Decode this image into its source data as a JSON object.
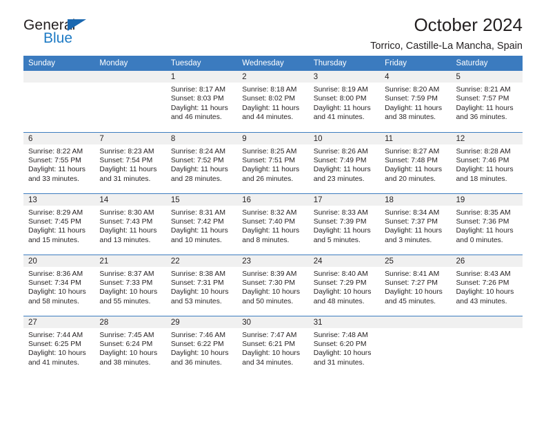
{
  "brand": {
    "name_part1": "General",
    "name_part2": "Blue"
  },
  "header": {
    "title": "October 2024",
    "subtitle": "Torrico, Castille-La Mancha, Spain"
  },
  "colors": {
    "header_blue": "#3b7bbf",
    "logo_blue": "#1d7ac4",
    "daynum_band": "#f0f0f0",
    "text": "#231f20"
  },
  "weekdays": [
    "Sunday",
    "Monday",
    "Tuesday",
    "Wednesday",
    "Thursday",
    "Friday",
    "Saturday"
  ],
  "calendar": {
    "weeks": [
      [
        {
          "day": "",
          "empty": true
        },
        {
          "day": "",
          "empty": true
        },
        {
          "day": "1",
          "sunrise": "Sunrise: 8:17 AM",
          "sunset": "Sunset: 8:03 PM",
          "daylight1": "Daylight: 11 hours",
          "daylight2": "and 46 minutes."
        },
        {
          "day": "2",
          "sunrise": "Sunrise: 8:18 AM",
          "sunset": "Sunset: 8:02 PM",
          "daylight1": "Daylight: 11 hours",
          "daylight2": "and 44 minutes."
        },
        {
          "day": "3",
          "sunrise": "Sunrise: 8:19 AM",
          "sunset": "Sunset: 8:00 PM",
          "daylight1": "Daylight: 11 hours",
          "daylight2": "and 41 minutes."
        },
        {
          "day": "4",
          "sunrise": "Sunrise: 8:20 AM",
          "sunset": "Sunset: 7:59 PM",
          "daylight1": "Daylight: 11 hours",
          "daylight2": "and 38 minutes."
        },
        {
          "day": "5",
          "sunrise": "Sunrise: 8:21 AM",
          "sunset": "Sunset: 7:57 PM",
          "daylight1": "Daylight: 11 hours",
          "daylight2": "and 36 minutes."
        }
      ],
      [
        {
          "day": "6",
          "sunrise": "Sunrise: 8:22 AM",
          "sunset": "Sunset: 7:55 PM",
          "daylight1": "Daylight: 11 hours",
          "daylight2": "and 33 minutes."
        },
        {
          "day": "7",
          "sunrise": "Sunrise: 8:23 AM",
          "sunset": "Sunset: 7:54 PM",
          "daylight1": "Daylight: 11 hours",
          "daylight2": "and 31 minutes."
        },
        {
          "day": "8",
          "sunrise": "Sunrise: 8:24 AM",
          "sunset": "Sunset: 7:52 PM",
          "daylight1": "Daylight: 11 hours",
          "daylight2": "and 28 minutes."
        },
        {
          "day": "9",
          "sunrise": "Sunrise: 8:25 AM",
          "sunset": "Sunset: 7:51 PM",
          "daylight1": "Daylight: 11 hours",
          "daylight2": "and 26 minutes."
        },
        {
          "day": "10",
          "sunrise": "Sunrise: 8:26 AM",
          "sunset": "Sunset: 7:49 PM",
          "daylight1": "Daylight: 11 hours",
          "daylight2": "and 23 minutes."
        },
        {
          "day": "11",
          "sunrise": "Sunrise: 8:27 AM",
          "sunset": "Sunset: 7:48 PM",
          "daylight1": "Daylight: 11 hours",
          "daylight2": "and 20 minutes."
        },
        {
          "day": "12",
          "sunrise": "Sunrise: 8:28 AM",
          "sunset": "Sunset: 7:46 PM",
          "daylight1": "Daylight: 11 hours",
          "daylight2": "and 18 minutes."
        }
      ],
      [
        {
          "day": "13",
          "sunrise": "Sunrise: 8:29 AM",
          "sunset": "Sunset: 7:45 PM",
          "daylight1": "Daylight: 11 hours",
          "daylight2": "and 15 minutes."
        },
        {
          "day": "14",
          "sunrise": "Sunrise: 8:30 AM",
          "sunset": "Sunset: 7:43 PM",
          "daylight1": "Daylight: 11 hours",
          "daylight2": "and 13 minutes."
        },
        {
          "day": "15",
          "sunrise": "Sunrise: 8:31 AM",
          "sunset": "Sunset: 7:42 PM",
          "daylight1": "Daylight: 11 hours",
          "daylight2": "and 10 minutes."
        },
        {
          "day": "16",
          "sunrise": "Sunrise: 8:32 AM",
          "sunset": "Sunset: 7:40 PM",
          "daylight1": "Daylight: 11 hours",
          "daylight2": "and 8 minutes."
        },
        {
          "day": "17",
          "sunrise": "Sunrise: 8:33 AM",
          "sunset": "Sunset: 7:39 PM",
          "daylight1": "Daylight: 11 hours",
          "daylight2": "and 5 minutes."
        },
        {
          "day": "18",
          "sunrise": "Sunrise: 8:34 AM",
          "sunset": "Sunset: 7:37 PM",
          "daylight1": "Daylight: 11 hours",
          "daylight2": "and 3 minutes."
        },
        {
          "day": "19",
          "sunrise": "Sunrise: 8:35 AM",
          "sunset": "Sunset: 7:36 PM",
          "daylight1": "Daylight: 11 hours",
          "daylight2": "and 0 minutes."
        }
      ],
      [
        {
          "day": "20",
          "sunrise": "Sunrise: 8:36 AM",
          "sunset": "Sunset: 7:34 PM",
          "daylight1": "Daylight: 10 hours",
          "daylight2": "and 58 minutes."
        },
        {
          "day": "21",
          "sunrise": "Sunrise: 8:37 AM",
          "sunset": "Sunset: 7:33 PM",
          "daylight1": "Daylight: 10 hours",
          "daylight2": "and 55 minutes."
        },
        {
          "day": "22",
          "sunrise": "Sunrise: 8:38 AM",
          "sunset": "Sunset: 7:31 PM",
          "daylight1": "Daylight: 10 hours",
          "daylight2": "and 53 minutes."
        },
        {
          "day": "23",
          "sunrise": "Sunrise: 8:39 AM",
          "sunset": "Sunset: 7:30 PM",
          "daylight1": "Daylight: 10 hours",
          "daylight2": "and 50 minutes."
        },
        {
          "day": "24",
          "sunrise": "Sunrise: 8:40 AM",
          "sunset": "Sunset: 7:29 PM",
          "daylight1": "Daylight: 10 hours",
          "daylight2": "and 48 minutes."
        },
        {
          "day": "25",
          "sunrise": "Sunrise: 8:41 AM",
          "sunset": "Sunset: 7:27 PM",
          "daylight1": "Daylight: 10 hours",
          "daylight2": "and 45 minutes."
        },
        {
          "day": "26",
          "sunrise": "Sunrise: 8:43 AM",
          "sunset": "Sunset: 7:26 PM",
          "daylight1": "Daylight: 10 hours",
          "daylight2": "and 43 minutes."
        }
      ],
      [
        {
          "day": "27",
          "sunrise": "Sunrise: 7:44 AM",
          "sunset": "Sunset: 6:25 PM",
          "daylight1": "Daylight: 10 hours",
          "daylight2": "and 41 minutes."
        },
        {
          "day": "28",
          "sunrise": "Sunrise: 7:45 AM",
          "sunset": "Sunset: 6:24 PM",
          "daylight1": "Daylight: 10 hours",
          "daylight2": "and 38 minutes."
        },
        {
          "day": "29",
          "sunrise": "Sunrise: 7:46 AM",
          "sunset": "Sunset: 6:22 PM",
          "daylight1": "Daylight: 10 hours",
          "daylight2": "and 36 minutes."
        },
        {
          "day": "30",
          "sunrise": "Sunrise: 7:47 AM",
          "sunset": "Sunset: 6:21 PM",
          "daylight1": "Daylight: 10 hours",
          "daylight2": "and 34 minutes."
        },
        {
          "day": "31",
          "sunrise": "Sunrise: 7:48 AM",
          "sunset": "Sunset: 6:20 PM",
          "daylight1": "Daylight: 10 hours",
          "daylight2": "and 31 minutes."
        },
        {
          "day": "",
          "empty": true
        },
        {
          "day": "",
          "empty": true
        }
      ]
    ]
  }
}
